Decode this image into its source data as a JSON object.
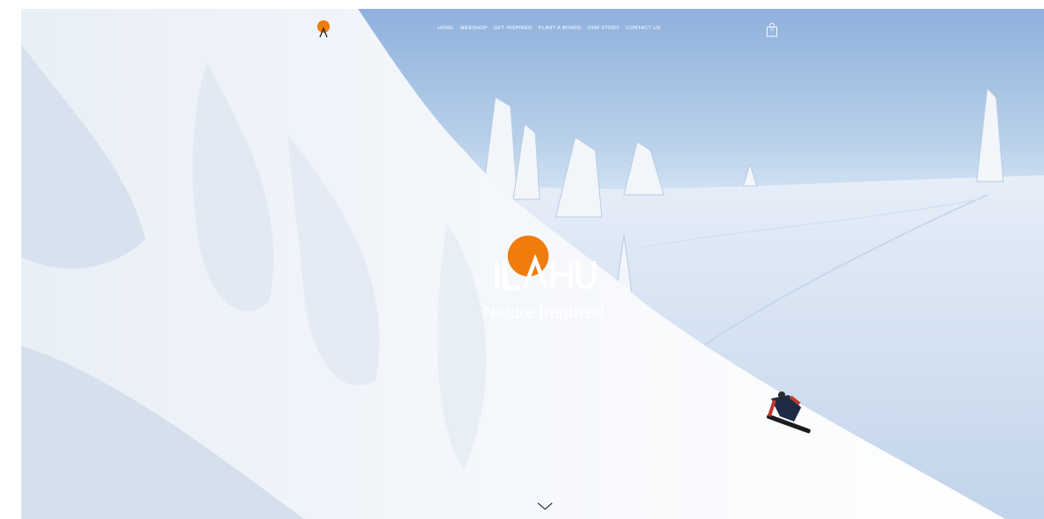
{
  "nav": {
    "items": [
      {
        "label": "HOME"
      },
      {
        "label": "WEBSHOP"
      },
      {
        "label": "GET INSPIRED"
      },
      {
        "label": "PLANT A BOARD"
      },
      {
        "label": "OUR STORY"
      },
      {
        "label": "CONTACT US"
      }
    ]
  },
  "cart": {
    "count": "0"
  },
  "hero": {
    "brand": "ILAHU",
    "tagline_part1": "Nature",
    "tagline_part2": "Inspired"
  },
  "colors": {
    "accent": "#f07c0c",
    "sky": "#a9c4e6",
    "snow": "#ffffff"
  },
  "icons": {
    "small_logo": "ilahu-sun-logo-icon",
    "cart": "shopping-bag-icon",
    "scroll": "chevron-down-icon"
  }
}
